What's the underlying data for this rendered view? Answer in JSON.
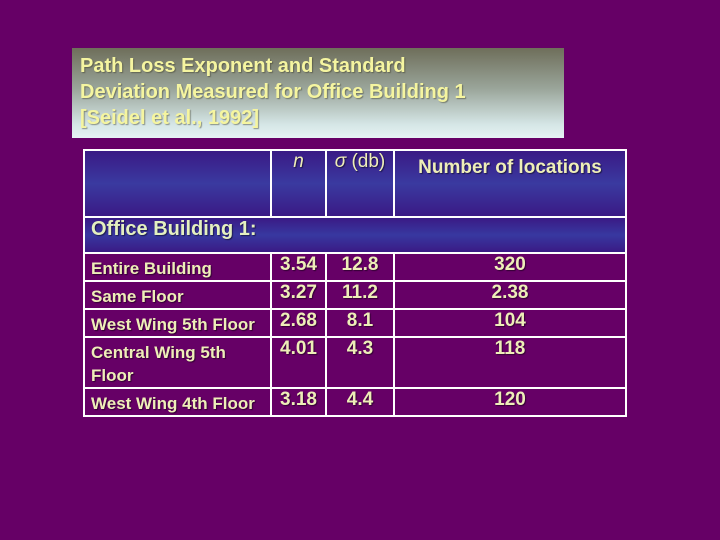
{
  "title": {
    "lines": [
      "Path Loss Exponent and Standard",
      "Deviation Measured for Office Building 1",
      "[Seidel et al., 1992]"
    ]
  },
  "table": {
    "headers": {
      "label": "",
      "n": "n",
      "sigma_symbol": "σ",
      "sigma_unit": " (db)",
      "locations": "Number of locations"
    },
    "group_label": "Office Building 1:",
    "rows": [
      {
        "label": "Entire Building",
        "n": "3.54",
        "sigma": "12.8",
        "locations": "320"
      },
      {
        "label": "Same Floor",
        "n": "3.27",
        "sigma": "11.2",
        "locations": "2.38"
      },
      {
        "label": "West Wing 5th Floor",
        "n": "2.68",
        "sigma": "8.1",
        "locations": "104"
      },
      {
        "label": "Central Wing 5th Floor",
        "n": "4.01",
        "sigma": "4.3",
        "locations": "118"
      },
      {
        "label": "West Wing 4th Floor",
        "n": "3.18",
        "sigma": "4.4",
        "locations": "120"
      }
    ]
  }
}
